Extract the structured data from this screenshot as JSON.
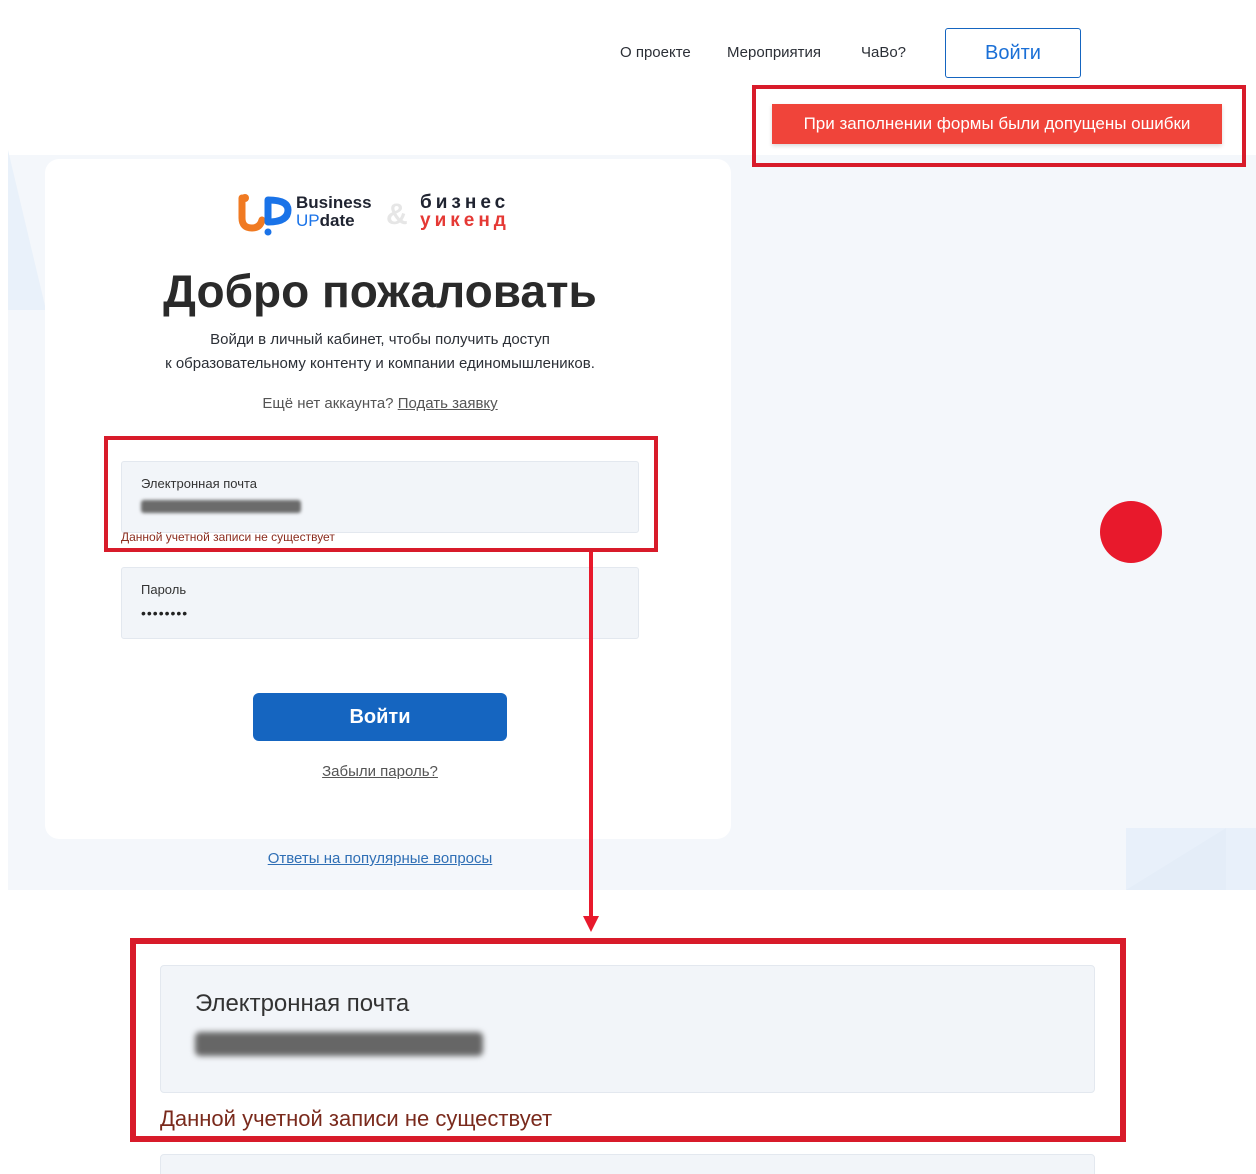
{
  "nav": {
    "links": [
      "О проекте",
      "Мероприятия",
      "ЧаВо?"
    ],
    "login_label": "Войти"
  },
  "toast": {
    "message": "При заполнении формы были допущены ошибки"
  },
  "logo": {
    "business_line1": "Business",
    "business_line2_up": "UP",
    "business_line2_rest": "date",
    "amp": "&",
    "weekend_line1": "бизнес",
    "weekend_line2": "уикенд"
  },
  "login": {
    "title": "Добро пожаловать",
    "subtitle_line1": "Войди в личный кабинет, чтобы получить доступ",
    "subtitle_line2": "к образовательному контенту и компании единомышлеников.",
    "no_account_text": "Ещё нет аккаунта?",
    "apply_link": "Подать заявку",
    "email_label": "Электронная почта",
    "email_error": "Данной учетной записи не существует",
    "password_label": "Пароль",
    "password_value": "••••••••",
    "submit_label": "Войти",
    "forgot_link": "Забыли пароль?",
    "faq_link": "Ответы на популярные вопросы"
  },
  "zoom": {
    "email_label": "Электронная почта",
    "email_error": "Данной учетной записи не существует"
  },
  "colors": {
    "accent": "#1565c0",
    "error_toast": "#f0443a",
    "highlight_frame": "#d81b2a",
    "error_text": "#8b2d1f"
  }
}
